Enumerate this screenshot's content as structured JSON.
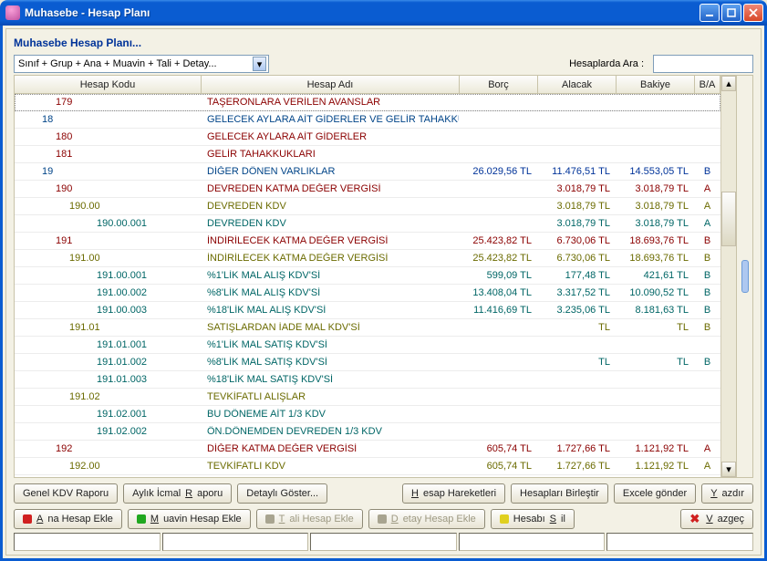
{
  "window": {
    "title": "Muhasebe - Hesap Planı"
  },
  "panel": {
    "title": "Muhasebe Hesap Planı..."
  },
  "dropdown": {
    "label": "Sınıf + Grup + Ana + Muavin + Tali + Detay..."
  },
  "search": {
    "label": "Hesaplarda Ara :",
    "value": ""
  },
  "columns": {
    "code": "Hesap Kodu",
    "name": "Hesap Adı",
    "borc": "Borç",
    "alacak": "Alacak",
    "bakiye": "Bakiye",
    "ba": "B/A"
  },
  "rows": [
    {
      "level": 1,
      "cls": "c-maroon",
      "code": "179",
      "name": "TAŞERONLARA VERİLEN AVANSLAR",
      "borc": "",
      "alacak": "",
      "bakiye": "",
      "ba": ""
    },
    {
      "level": 0,
      "cls": "c-blue",
      "code": "18",
      "name": "GELECEK AYLARA AİT GİDERLER VE GELİR TAHAKKUKLAR",
      "borc": "",
      "alacak": "",
      "bakiye": "",
      "ba": ""
    },
    {
      "level": 1,
      "cls": "c-maroon",
      "code": "180",
      "name": "GELECEK AYLARA AİT GİDERLER",
      "borc": "",
      "alacak": "",
      "bakiye": "",
      "ba": ""
    },
    {
      "level": 1,
      "cls": "c-maroon",
      "code": "181",
      "name": "GELİR TAHAKKUKLARI",
      "borc": "",
      "alacak": "",
      "bakiye": "",
      "ba": ""
    },
    {
      "level": 0,
      "cls": "c-blue",
      "code": "19",
      "name": "DİĞER DÖNEN VARLIKLAR",
      "borc": "26.029,56 TL",
      "alacak": "11.476,51 TL",
      "bakiye": "14.553,05 TL",
      "ba": "B"
    },
    {
      "level": 1,
      "cls": "c-maroon",
      "code": "190",
      "name": "DEVREDEN KATMA DEĞER VERGİSİ",
      "borc": "",
      "alacak": "3.018,79 TL",
      "bakiye": "3.018,79 TL",
      "ba": "A"
    },
    {
      "level": 2,
      "cls": "c-olive",
      "code": "190.00",
      "name": "DEVREDEN KDV",
      "borc": "",
      "alacak": "3.018,79 TL",
      "bakiye": "3.018,79 TL",
      "ba": "A"
    },
    {
      "level": 3,
      "cls": "c-teal",
      "code": "190.00.001",
      "name": "DEVREDEN KDV",
      "borc": "",
      "alacak": "3.018,79 TL",
      "bakiye": "3.018,79 TL",
      "ba": "A"
    },
    {
      "level": 1,
      "cls": "c-maroon",
      "code": "191",
      "name": "İNDİRİLECEK KATMA DEĞER VERGİSİ",
      "borc": "25.423,82 TL",
      "alacak": "6.730,06 TL",
      "bakiye": "18.693,76 TL",
      "ba": "B"
    },
    {
      "level": 2,
      "cls": "c-olive",
      "code": "191.00",
      "name": "İNDİRİLECEK KATMA DEĞER VERGİSİ",
      "borc": "25.423,82 TL",
      "alacak": "6.730,06 TL",
      "bakiye": "18.693,76 TL",
      "ba": "B"
    },
    {
      "level": 3,
      "cls": "c-teal",
      "code": "191.00.001",
      "name": "%1'LİK MAL ALIŞ KDV'Sİ",
      "borc": "599,09 TL",
      "alacak": "177,48 TL",
      "bakiye": "421,61 TL",
      "ba": "B"
    },
    {
      "level": 3,
      "cls": "c-teal",
      "code": "191.00.002",
      "name": "%8'LİK MAL ALIŞ KDV'Sİ",
      "borc": "13.408,04 TL",
      "alacak": "3.317,52 TL",
      "bakiye": "10.090,52 TL",
      "ba": "B"
    },
    {
      "level": 3,
      "cls": "c-teal",
      "code": "191.00.003",
      "name": "%18'LİK MAL ALIŞ KDV'Sİ",
      "borc": "11.416,69 TL",
      "alacak": "3.235,06 TL",
      "bakiye": "8.181,63 TL",
      "ba": "B"
    },
    {
      "level": 2,
      "cls": "c-olive",
      "code": "191.01",
      "name": "SATIŞLARDAN İADE MAL KDV'Sİ",
      "borc": "",
      "alacak": "TL",
      "bakiye": "TL",
      "ba": "B"
    },
    {
      "level": 3,
      "cls": "c-teal",
      "code": "191.01.001",
      "name": "%1'LİK MAL SATIŞ KDV'Sİ",
      "borc": "",
      "alacak": "",
      "bakiye": "",
      "ba": ""
    },
    {
      "level": 3,
      "cls": "c-teal",
      "code": "191.01.002",
      "name": "%8'LİK MAL SATIŞ KDV'Sİ",
      "borc": "",
      "alacak": "TL",
      "bakiye": "TL",
      "ba": "B"
    },
    {
      "level": 3,
      "cls": "c-teal",
      "code": "191.01.003",
      "name": "%18'LİK MAL SATIŞ KDV'Sİ",
      "borc": "",
      "alacak": "",
      "bakiye": "",
      "ba": ""
    },
    {
      "level": 2,
      "cls": "c-olive",
      "code": "191.02",
      "name": "TEVKİFATLI ALIŞLAR",
      "borc": "",
      "alacak": "",
      "bakiye": "",
      "ba": ""
    },
    {
      "level": 3,
      "cls": "c-teal",
      "code": "191.02.001",
      "name": "BU DÖNEME AİT 1/3 KDV",
      "borc": "",
      "alacak": "",
      "bakiye": "",
      "ba": ""
    },
    {
      "level": 3,
      "cls": "c-teal",
      "code": "191.02.002",
      "name": "ÖN.DÖNEMDEN DEVREDEN 1/3 KDV",
      "borc": "",
      "alacak": "",
      "bakiye": "",
      "ba": ""
    },
    {
      "level": 1,
      "cls": "c-maroon",
      "code": "192",
      "name": "DİĞER KATMA DEĞER VERGİSİ",
      "borc": "605,74 TL",
      "alacak": "1.727,66 TL",
      "bakiye": "1.121,92 TL",
      "ba": "A"
    },
    {
      "level": 2,
      "cls": "c-olive",
      "code": "192.00",
      "name": "TEVKİFATLI KDV",
      "borc": "605,74 TL",
      "alacak": "1.727,66 TL",
      "bakiye": "1.121,92 TL",
      "ba": "A"
    }
  ],
  "buttons": {
    "genel_kdv": "Genel KDV Raporu",
    "aylik_icmal_pre": "Aylık İcmal ",
    "aylik_icmal_u": "R",
    "aylik_icmal_post": "aporu",
    "detayli": "Detaylı Göster...",
    "hareket_pre": "",
    "hareket_u": "H",
    "hareket_post": "esap Hareketleri",
    "birlestir": "Hesapları Birleştir",
    "excel": "Excele gönder",
    "yazdir_u": "Y",
    "yazdir_post": "azdır",
    "ana_u": "A",
    "ana_post": "na Hesap Ekle",
    "muavin_u": "M",
    "muavin_post": "uavin Hesap Ekle",
    "tali_u": "T",
    "tali_post": "ali Hesap Ekle",
    "detay_u": "D",
    "detay_post": "etay Hesap Ekle",
    "sil_pre": "Hesabı ",
    "sil_u": "S",
    "sil_post": "il",
    "vazgec_u": "V",
    "vazgec_post": "azgeç"
  }
}
